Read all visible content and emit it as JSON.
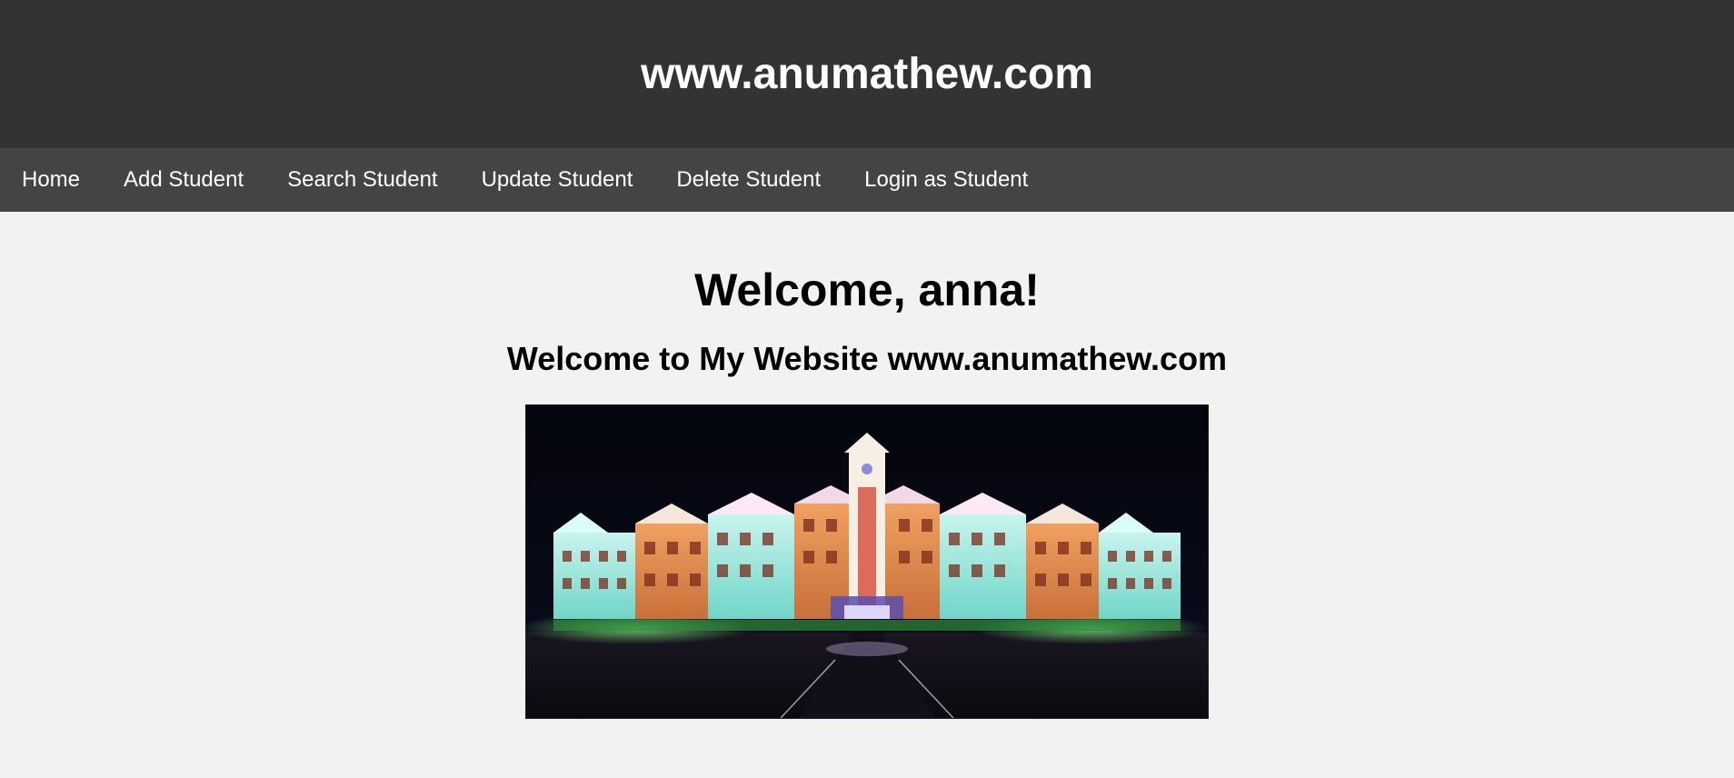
{
  "header": {
    "site_title": "www.anumathew.com"
  },
  "nav": {
    "items": [
      {
        "label": "Home"
      },
      {
        "label": "Add Student"
      },
      {
        "label": "Search Student"
      },
      {
        "label": "Update Student"
      },
      {
        "label": "Delete Student"
      },
      {
        "label": "Login as Student"
      }
    ]
  },
  "main": {
    "welcome_user": "Welcome, anna!",
    "welcome_site": "Welcome to My Website www.anumathew.com"
  },
  "colors": {
    "header_bg": "#333333",
    "nav_bg": "#444444",
    "page_bg": "#f2f2f2",
    "header_text": "#ffffff",
    "body_text": "#000000"
  }
}
